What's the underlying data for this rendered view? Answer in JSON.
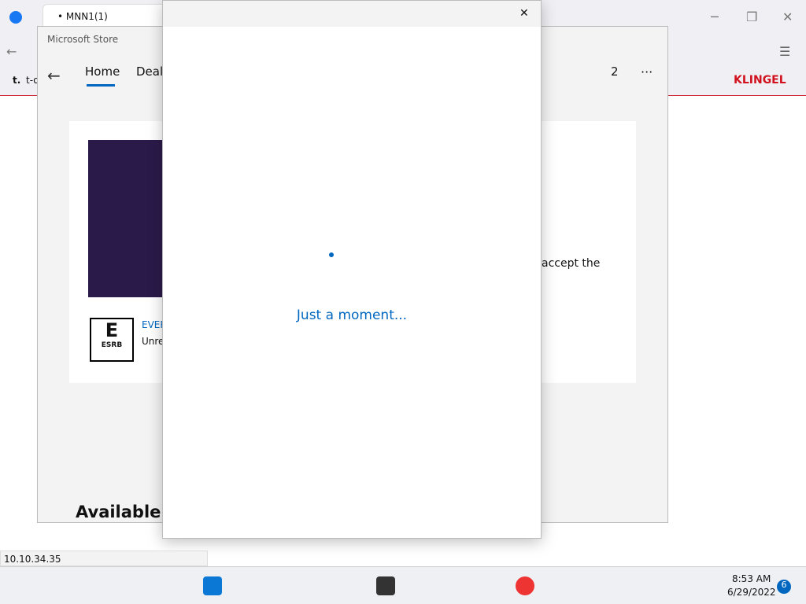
{
  "browser": {
    "tab_title": "MNN1(1)",
    "bookmark_t": "t.",
    "bookmark_text": "t-o",
    "brand_logo": "KLINGEL"
  },
  "store": {
    "title": "Microsoft Store",
    "nav": {
      "home": "Home",
      "deals": "Deals",
      "downloads": "2",
      "more": "···"
    },
    "body_fragment": "accept the",
    "esrb_fragment": "EVERY",
    "unrated_fragment": "Unre",
    "available_heading": "Available o",
    "esrb_letter": "E",
    "esrb_label": "ESRB"
  },
  "dialog": {
    "loading": "Just a moment..."
  },
  "statusbar": {
    "ip": "10.10.34.35"
  },
  "taskbar": {
    "time": "8:53 AM",
    "date": "6/29/2022",
    "notifications": "6"
  }
}
